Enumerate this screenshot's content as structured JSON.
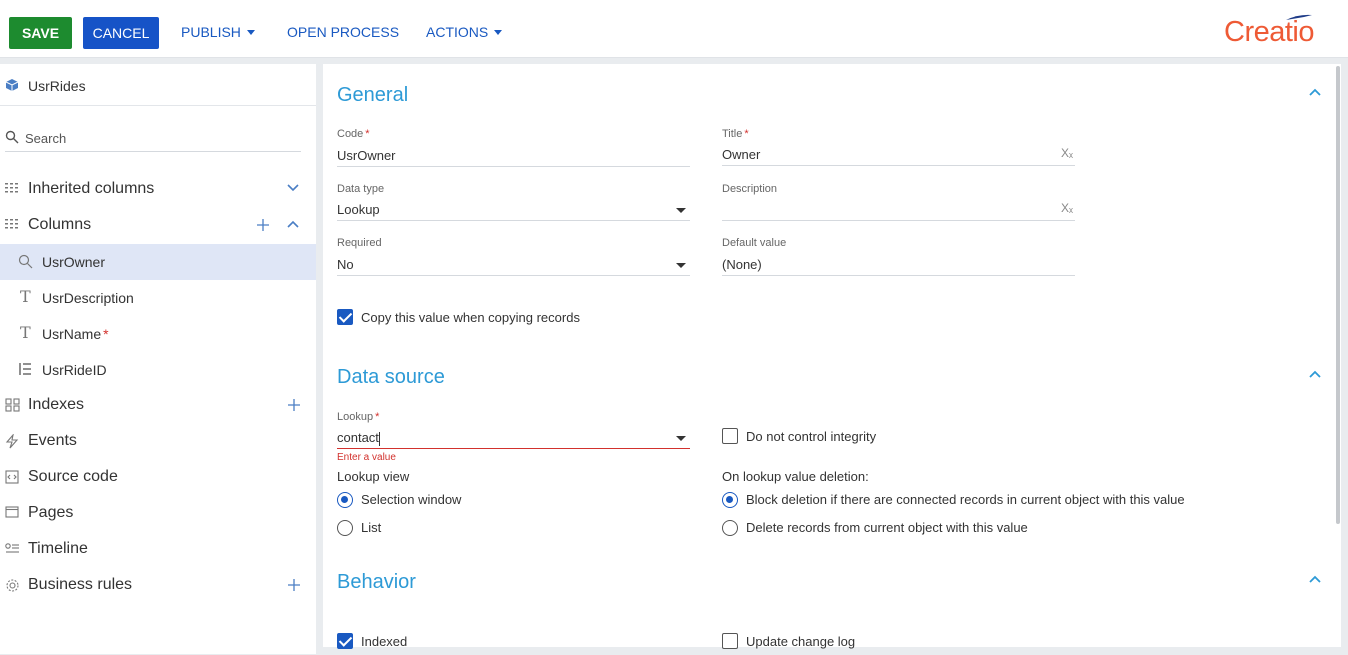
{
  "toolbar": {
    "save_label": "SAVE",
    "cancel_label": "CANCEL",
    "publish_label": "PUBLISH",
    "open_process_label": "OPEN PROCESS",
    "actions_label": "ACTIONS",
    "logo_text": "Creatio",
    "logo_color": "#ee5a35"
  },
  "sidebar": {
    "object_name": "UsrRides",
    "search_placeholder": "Search",
    "inherited_columns_label": "Inherited columns",
    "columns_label": "Columns",
    "columns": [
      {
        "name": "UsrOwner",
        "icon": "lookup-icon",
        "required": false,
        "selected": true
      },
      {
        "name": "UsrDescription",
        "icon": "text-icon",
        "required": false,
        "selected": false
      },
      {
        "name": "UsrName",
        "icon": "text-icon",
        "required": true,
        "selected": false
      },
      {
        "name": "UsrRideID",
        "icon": "number-list-icon",
        "required": false,
        "selected": false
      }
    ],
    "indexes_label": "Indexes",
    "events_label": "Events",
    "source_code_label": "Source code",
    "pages_label": "Pages",
    "timeline_label": "Timeline",
    "business_rules_label": "Business rules"
  },
  "general": {
    "title": "General",
    "code_label": "Code",
    "code_value": "UsrOwner",
    "title_label": "Title",
    "title_value": "Owner",
    "data_type_label": "Data type",
    "data_type_value": "Lookup",
    "description_label": "Description",
    "description_value": "",
    "required_label": "Required",
    "required_value": "No",
    "default_value_label": "Default value",
    "default_value_value": "(None)",
    "copy_value_label": "Copy this value when copying records",
    "copy_value_checked": true
  },
  "data_source": {
    "title": "Data source",
    "lookup_label": "Lookup",
    "lookup_value": "contact",
    "lookup_error": "Enter a value",
    "do_not_control_integrity_label": "Do not control integrity",
    "do_not_control_integrity_checked": false,
    "lookup_view_label": "Lookup view",
    "lookup_view_options": [
      "Selection window",
      "List"
    ],
    "lookup_view_selected": "Selection window",
    "on_deletion_label": "On lookup value deletion:",
    "on_deletion_options": [
      "Block deletion if there are connected records in current object with this value",
      "Delete records from current object with this value"
    ],
    "on_deletion_selected": "Block deletion if there are connected records in current object with this value"
  },
  "behavior": {
    "title": "Behavior",
    "indexed_label": "Indexed",
    "indexed_checked": true,
    "update_change_log_label": "Update change log",
    "update_change_log_checked": false
  },
  "colors": {
    "save": "#1d8b2f",
    "cancel": "#1653c7",
    "link": "#1959c1",
    "section_title": "#2d9ad6",
    "error": "#d2312d"
  }
}
